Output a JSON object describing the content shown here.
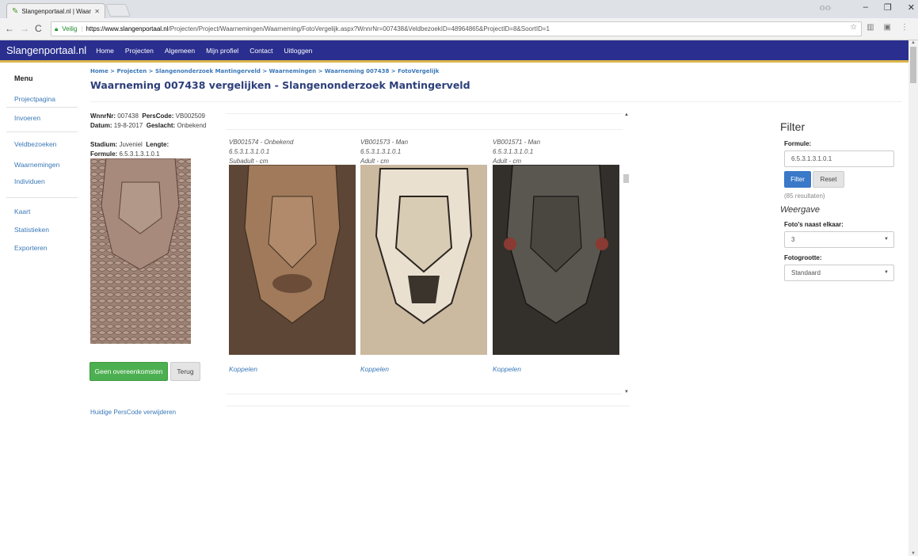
{
  "browser": {
    "tab_title": "Slangenportaal.nl | Waar",
    "secure_label": "Veilig",
    "url_host": "https://www.slangenportaal.nl",
    "url_path": "/Projecten/Project/Waarnemingen/Waarneming/FotoVergelijk.aspx?WnnrNr=007438&VeldbezoekID=48964865&ProjectID=8&SoortID=1"
  },
  "site_nav": {
    "brand": "Slangenportaal.nl",
    "links": [
      "Home",
      "Projecten",
      "Algemeen",
      "Mijn profiel",
      "Contact",
      "Uitloggen"
    ]
  },
  "sidebar": {
    "title": "Menu",
    "items": [
      "Projectpagina",
      "Invoeren",
      "Veldbezoeken",
      "Waarnemingen",
      "Individuen",
      "Kaart",
      "Statistieken",
      "Exporteren"
    ]
  },
  "breadcrumb": "Home > Projecten > Slangenonderzoek Mantingerveld > Waarnemingen > Waarneming 007438 > FotoVergelijk",
  "page_title": "Waarneming 007438 vergelijken - Slangenonderzoek Mantingerveld",
  "observation": {
    "wnnrnr_label": "WnnrNr:",
    "wnnrnr": "007438",
    "perscode_label": "PersCode:",
    "perscode": "VB002509",
    "datum_label": "Datum:",
    "datum": "19-8-2017",
    "geslacht_label": "Geslacht:",
    "geslacht": "Onbekend",
    "stadium_label": "Stadium:",
    "stadium": "Juveniel",
    "lengte_label": "Lengte:",
    "lengte": "",
    "formule_label": "Formule:",
    "formule": "6.5.3.1.3.1.0.1"
  },
  "buttons": {
    "no_match": "Geen overeenkomsten",
    "back": "Terug",
    "remove_perscode": "Huidige PersCode verwijderen"
  },
  "cards": [
    {
      "line1": "VB001574 - Onbekend",
      "line2": "6.5.3.1.3.1.0.1",
      "line3": "Subadult - cm",
      "link": "Koppelen",
      "tone": "#8a6a4f"
    },
    {
      "line1": "VB001573 - Man",
      "line2": "6.5.3.1.3.1.0.1",
      "line3": "Adult - cm",
      "link": "Koppelen",
      "tone": "#9a9070"
    },
    {
      "line1": "VB001571 - Man",
      "line2": "6.5.3.1.3.1.0.1",
      "line3": "Adult - cm",
      "link": "Koppelen",
      "tone": "#4a4640"
    }
  ],
  "filter": {
    "title": "Filter",
    "formule_label": "Formule:",
    "formule_value": "6.5.3.1.3.1.0.1",
    "filter_btn": "Filter",
    "reset_btn": "Reset",
    "results": "(85 resultaten)",
    "weergave": "Weergave",
    "naast_label": "Foto's naast elkaar:",
    "naast_value": "3",
    "grootte_label": "Fotogrootte:",
    "grootte_value": "Standaard"
  },
  "icons": [
    "back-arrow-icon",
    "forward-arrow-icon",
    "reload-icon",
    "lock-icon",
    "star-icon",
    "extension-icon",
    "menu-icon",
    "dropdown-caret-icon"
  ]
}
